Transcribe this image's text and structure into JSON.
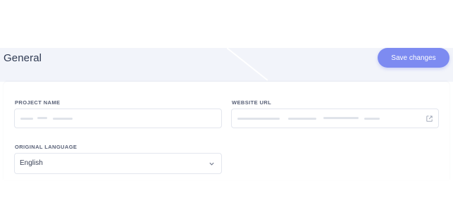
{
  "header": {
    "title": "General",
    "save_label": "Save changes"
  },
  "form": {
    "project_name": {
      "label": "PROJECT NAME",
      "value": ""
    },
    "website_url": {
      "label": "WEBSITE URL",
      "value": "",
      "icon": "external-link-icon"
    },
    "original_language": {
      "label": "ORIGINAL LANGUAGE",
      "value": "English",
      "icon": "chevron-down-icon"
    }
  },
  "colors": {
    "accent": "#7d8bf1",
    "header_background": "#f2f4fa",
    "title_text": "#2f3a52"
  }
}
